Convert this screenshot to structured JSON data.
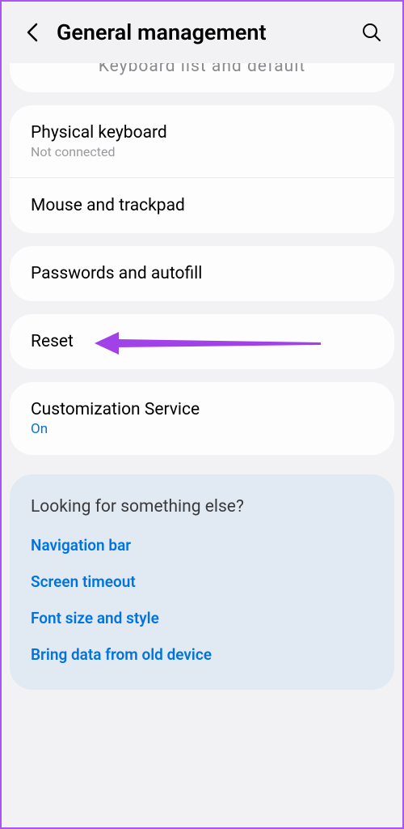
{
  "header": {
    "title": "General management"
  },
  "truncated": {
    "text": "Keyboard list and default"
  },
  "sections": {
    "physical_keyboard": {
      "title": "Physical keyboard",
      "subtitle": "Not connected"
    },
    "mouse_trackpad": {
      "title": "Mouse and trackpad"
    },
    "passwords_autofill": {
      "title": "Passwords and autofill"
    },
    "reset": {
      "title": "Reset"
    },
    "customization": {
      "title": "Customization Service",
      "subtitle": "On"
    }
  },
  "suggestions": {
    "title": "Looking for something else?",
    "links": {
      "nav": "Navigation bar",
      "timeout": "Screen timeout",
      "font": "Font size and style",
      "bring": "Bring data from old device"
    }
  },
  "colors": {
    "arrow": "#a142e8"
  }
}
